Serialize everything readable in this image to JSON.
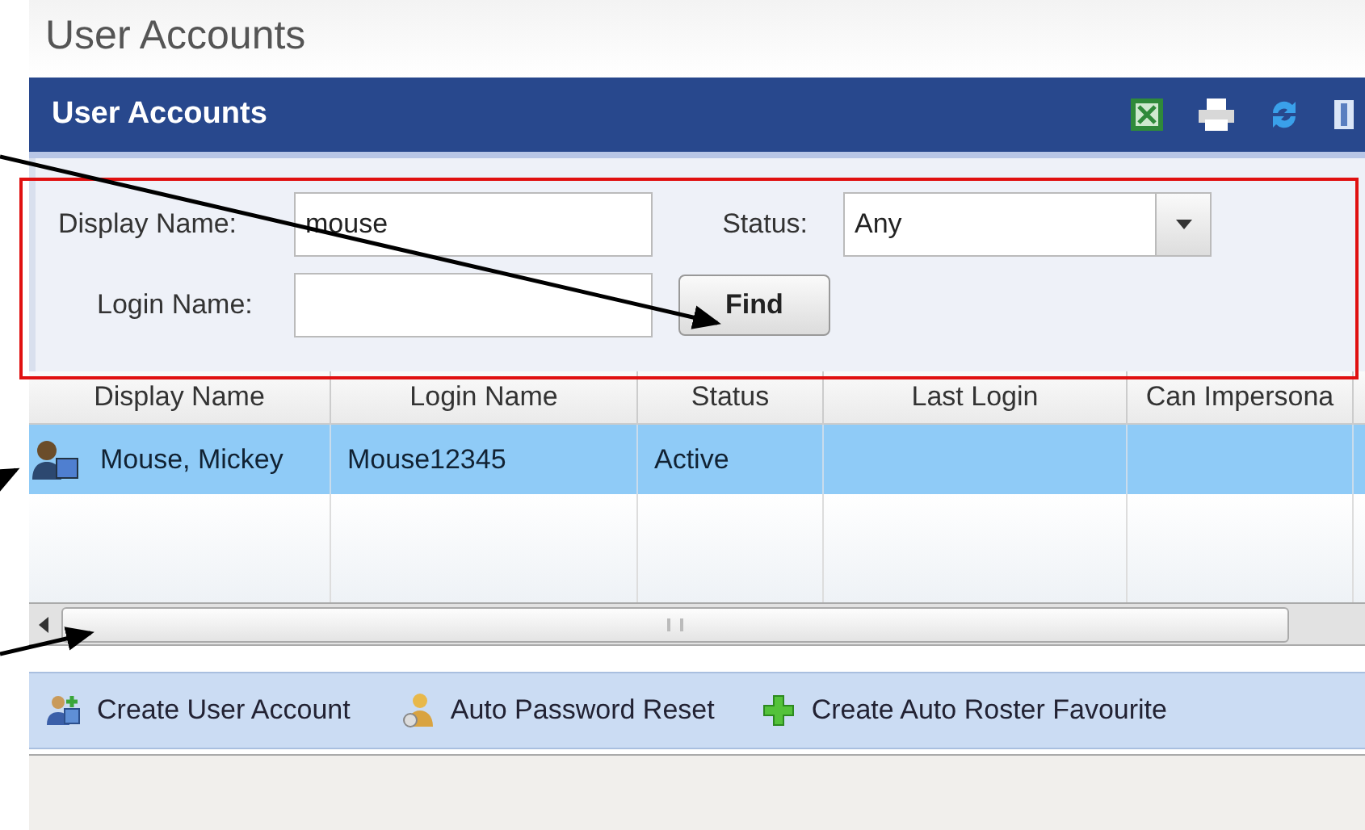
{
  "page_title": "User Accounts",
  "panel": {
    "title": "User Accounts"
  },
  "filters": {
    "display_name": {
      "label": "Display Name:",
      "value": "mouse"
    },
    "status": {
      "label": "Status:",
      "value": "Any"
    },
    "login_name": {
      "label": "Login Name:"
    },
    "find_button": "Find"
  },
  "table": {
    "columns": [
      "Display Name",
      "Login Name",
      "Status",
      "Last Login",
      "Can Impersona"
    ],
    "rows": [
      {
        "selected": true,
        "cells": [
          "Mouse, Mickey",
          "Mouse12345",
          "Active",
          "",
          ""
        ]
      }
    ]
  },
  "actions": [
    {
      "kind": "user",
      "label": "Create User Account"
    },
    {
      "kind": "key",
      "label": "Auto Password Reset"
    },
    {
      "kind": "plus",
      "label": "Create Auto Roster Favourite"
    }
  ]
}
